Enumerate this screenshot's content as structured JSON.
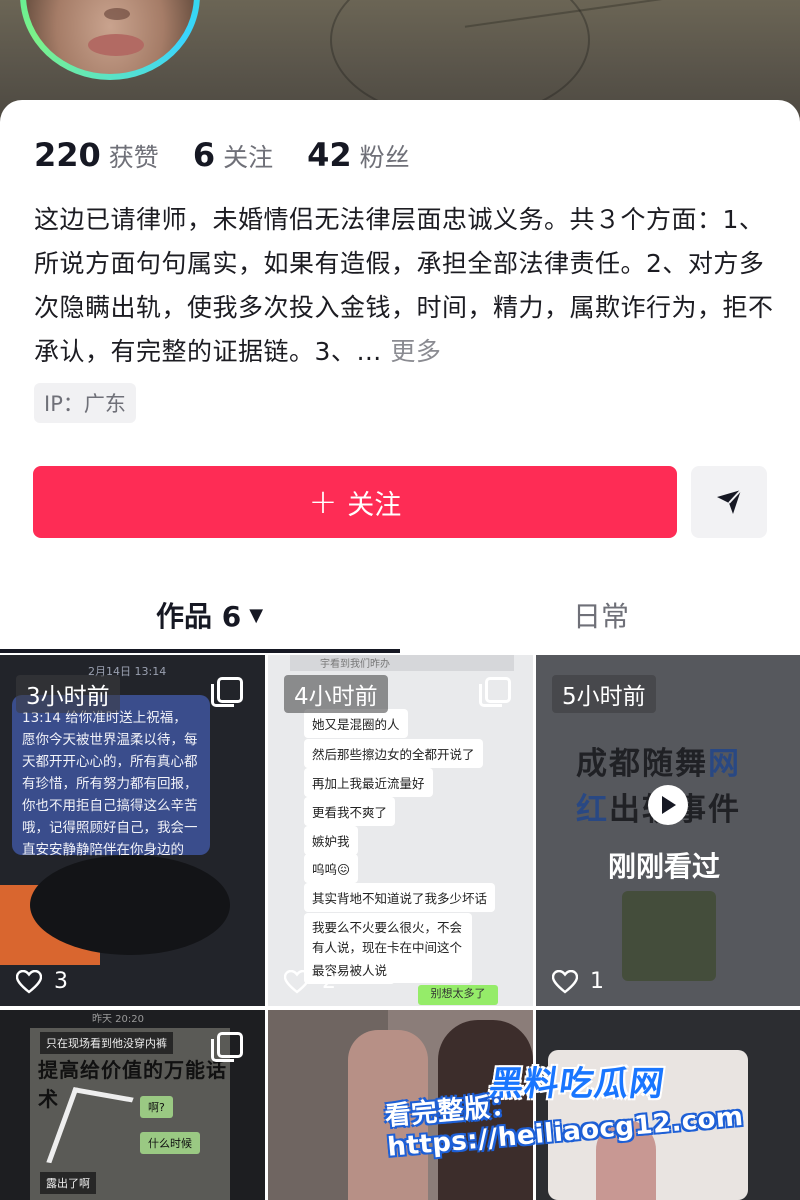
{
  "profile": {
    "stats": [
      {
        "value": "220",
        "label": "获赞"
      },
      {
        "value": "6",
        "label": "关注"
      },
      {
        "value": "42",
        "label": "粉丝"
      }
    ],
    "bio": "这边已请律师，未婚情侣无法律层面忠诚义务。共３个方面：1、所说方面句句属实，如果有造假，承担全部法律责任。2、对方多次隐瞒出轨，使我多次投入金钱，时间，精力，属欺诈行为，拒不承认，有完整的证据链。3、…",
    "bio_more": "更多",
    "ip": "IP：广东"
  },
  "actions": {
    "follow_label": "关注",
    "follow_plus": "+",
    "share_icon": "send-icon"
  },
  "colors": {
    "follow_button": "#fe2c55",
    "watermark_blue": "#1976ff"
  },
  "tabs": [
    {
      "label": "作品 6",
      "active": true
    },
    {
      "label": "日常",
      "active": false
    }
  ],
  "videos": [
    {
      "time": "3小时前",
      "likes": "3",
      "chat_stamp": "2月14日 13:14",
      "chat_text": "13:14 给你准时送上祝福，愿你今天被世界温柔以待，每天都开开心心的，所有真心都有珍惜，所有努力都有回报，你也不用拒自己搞得这么辛苦哦，记得照顾好自己，我会一直安安静静陪伴在你身边的"
    },
    {
      "time": "4小时前",
      "likes": "2",
      "top_bar": "宇看到我们昨办",
      "messages": [
        "她又是混圈的人",
        "然后那些擦边女的全都开说了",
        "再加上我最近流量好",
        "更看我不爽了",
        "嫉妒我",
        "呜呜😖",
        "其实背地不知道说了我多少坏话",
        "我要么不火要么很火，不会有人说，现在卡在中间这个阶段",
        "最容易被人说"
      ],
      "reply_button": "别想太多了"
    },
    {
      "time": "5小时前",
      "likes": "1",
      "headline_part1": "成都随舞",
      "headline_blue1": "网",
      "headline_blue2": "红",
      "headline_part2": "出轨事件",
      "watched": "刚刚看过"
    },
    {
      "stamp": "昨天 20:20",
      "note_top": "只在现场看到他没穿内裤",
      "title": "提高给价值的万能话术",
      "ask1": "啊?",
      "ask2": "什么时候",
      "note_bottom": "露出了啊"
    },
    {},
    {}
  ],
  "watermark": {
    "brand": "黑料吃瓜网",
    "url": "看完整版：https://heiliaocg12.com"
  }
}
